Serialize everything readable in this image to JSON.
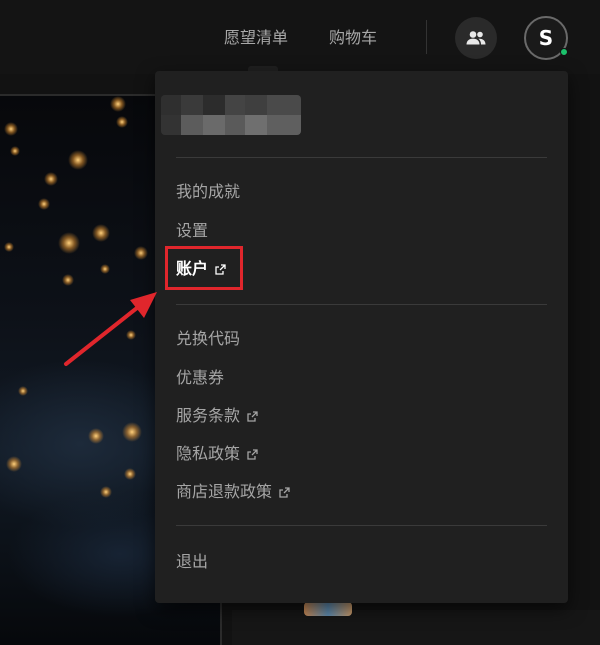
{
  "header": {
    "wishlist_label": "愿望清单",
    "cart_label": "购物车",
    "friends_icon": "friends-icon",
    "avatar_letter": "S",
    "online_color": "#1bc16b"
  },
  "dropdown": {
    "menu_groups": [
      [
        {
          "label": "我的成就",
          "external": false
        },
        {
          "label": "设置",
          "external": false
        },
        {
          "label": "账户",
          "external": true,
          "highlighted": true
        }
      ],
      [
        {
          "label": "兑换代码",
          "external": false
        },
        {
          "label": "优惠券",
          "external": false
        },
        {
          "label": "服务条款",
          "external": true
        },
        {
          "label": "隐私政策",
          "external": true
        },
        {
          "label": "商店退款政策",
          "external": true
        }
      ],
      [
        {
          "label": "退出",
          "external": false
        }
      ]
    ]
  },
  "annotation": {
    "highlight_color": "#e0262c"
  }
}
